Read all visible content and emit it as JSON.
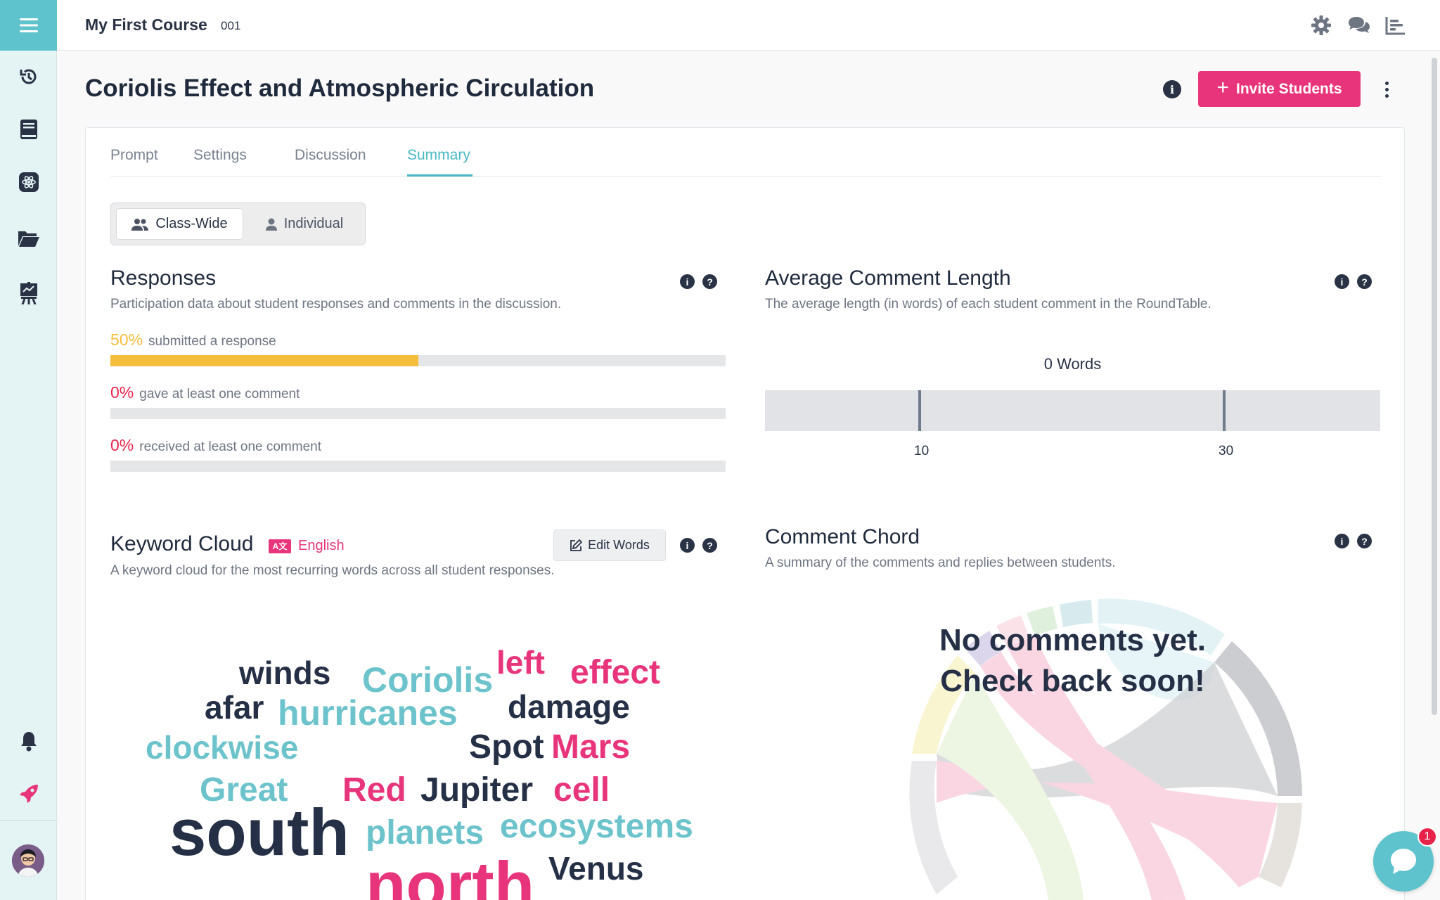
{
  "course": {
    "title": "My First Course",
    "code": "001"
  },
  "page": {
    "title": "Coriolis Effect and Atmospheric Circulation",
    "invite_label": "Invite Students"
  },
  "tabs": [
    {
      "label": "Prompt"
    },
    {
      "label": "Settings"
    },
    {
      "label": "Discussion"
    },
    {
      "label": "Summary",
      "active": true
    }
  ],
  "view_toggle": {
    "class_wide": "Class-Wide",
    "individual": "Individual",
    "selected": "Class-Wide"
  },
  "responses": {
    "title": "Responses",
    "description": "Participation data about student responses and comments in the discussion.",
    "stats": [
      {
        "pct": "50%",
        "label": "submitted a response",
        "value": 0.5,
        "color": "#f5bd3c"
      },
      {
        "pct": "0%",
        "label": "gave at least one comment",
        "value": 0,
        "color": "#e8234b"
      },
      {
        "pct": "0%",
        "label": "received at least one comment",
        "value": 0,
        "color": "#e8234b"
      }
    ]
  },
  "avg_length": {
    "title": "Average Comment Length",
    "description": "The average length (in words) of each student comment in the RoundTable.",
    "value_label": "0 Words",
    "ticks": [
      "10",
      "30"
    ]
  },
  "keyword_cloud": {
    "title": "Keyword Cloud",
    "language": "English",
    "language_icon": "A文",
    "edit_label": "Edit Words",
    "description": "A keyword cloud for the most recurring words across all student responses.",
    "words": [
      "winds",
      "Coriolis",
      "left",
      "effect",
      "afar",
      "hurricanes",
      "damage",
      "clockwise",
      "Spot",
      "Mars",
      "Great",
      "Red",
      "Jupiter",
      "cell",
      "south",
      "planets",
      "ecosystems",
      "north",
      "Venus"
    ]
  },
  "comment_chord": {
    "title": "Comment Chord",
    "description": "A summary of the comments and replies between students.",
    "empty_line1": "No comments yet.",
    "empty_line2": "Check back soon!"
  },
  "chat": {
    "badge": "1"
  },
  "colors": {
    "accent_teal": "#5ec3cc",
    "accent_pink": "#e8347a",
    "bar_yellow": "#f5bd3c",
    "text_navy": "#253046"
  }
}
